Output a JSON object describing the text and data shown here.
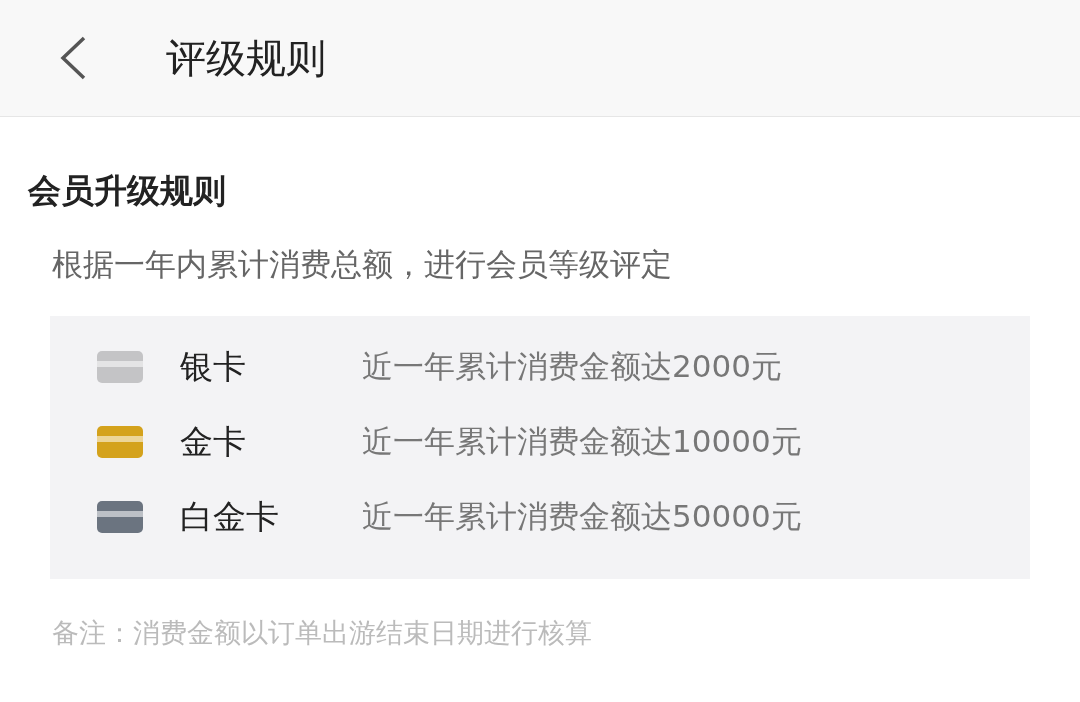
{
  "header": {
    "title": "评级规则"
  },
  "section": {
    "title": "会员升级规则",
    "description": "根据一年内累计消费总额，进行会员等级评定"
  },
  "levels": [
    {
      "name": "银卡",
      "requirement": "近一年累计消费金额达2000元",
      "color": "#c4c4c6"
    },
    {
      "name": "金卡",
      "requirement": "近一年累计消费金额达10000元",
      "color": "#d4a21c"
    },
    {
      "name": "白金卡",
      "requirement": "近一年累计消费金额达50000元",
      "color": "#6b7480"
    }
  ],
  "note": "备注：消费金额以订单出游结束日期进行核算"
}
